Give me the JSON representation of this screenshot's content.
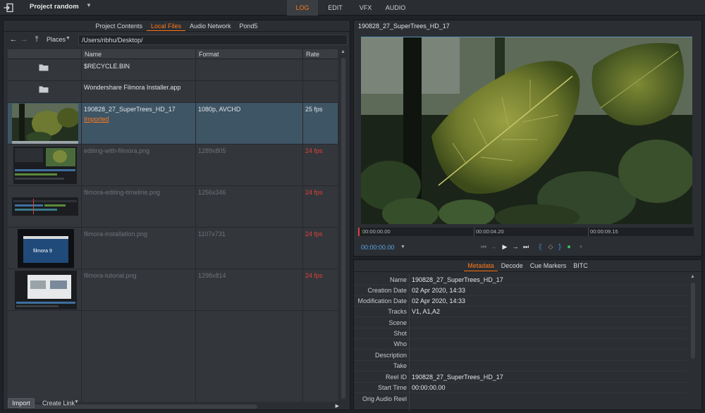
{
  "app": {
    "project_name": "Project random",
    "main_tabs": [
      "LOG",
      "EDIT",
      "VFX",
      "AUDIO"
    ]
  },
  "browser": {
    "tabs": [
      "Project Contents",
      "Local Files",
      "Audio Network",
      "Pond5"
    ],
    "places_label": "Places",
    "path": "/Users/ribhu/Desktop/",
    "columns": [
      "Name",
      "Format",
      "Rate"
    ],
    "rows": [
      {
        "name": "$RECYCLE.BIN",
        "format": "",
        "rate": "",
        "kind": "folder"
      },
      {
        "name": "Wondershare Filmora Installer.app",
        "format": "",
        "rate": "",
        "kind": "folder"
      },
      {
        "name": "190828_27_SuperTrees_HD_17",
        "format": "1080p, AVCHD",
        "rate": "25 fps",
        "kind": "video",
        "status": "Imported"
      },
      {
        "name": "editing-with-filmora.png",
        "format": "1289x805",
        "rate": "24 fps",
        "kind": "image"
      },
      {
        "name": "filmora-editing-timeline.png",
        "format": "1256x346",
        "rate": "24 fps",
        "kind": "image"
      },
      {
        "name": "filmora-installation.png",
        "format": "1107x731",
        "rate": "24 fps",
        "kind": "image"
      },
      {
        "name": "filmora-tutorial.png",
        "format": "1298x814",
        "rate": "24 fps",
        "kind": "image"
      }
    ],
    "import_label": "Import",
    "create_link_label": "Create Link"
  },
  "viewer": {
    "title": "190828_27_SuperTrees_HD_17",
    "ticks": [
      "00:00:00.00",
      "00:00:04.20",
      "00:00:09.15"
    ],
    "timecode": "00:00:00.00"
  },
  "metadata": {
    "tabs": [
      "Metadata",
      "Decode",
      "Cue Markers",
      "BITC"
    ],
    "fields": [
      {
        "label": "Name",
        "value": "190828_27_SuperTrees_HD_17"
      },
      {
        "label": "Creation Date",
        "value": "02 Apr 2020, 14:33"
      },
      {
        "label": "Modification Date",
        "value": "02 Apr 2020, 14:33"
      },
      {
        "label": "Tracks",
        "value": "V1, A1,A2"
      },
      {
        "label": "Scene",
        "value": ""
      },
      {
        "label": "Shot",
        "value": ""
      },
      {
        "label": "Who",
        "value": ""
      },
      {
        "label": "Description",
        "value": ""
      },
      {
        "label": "Take",
        "value": ""
      },
      {
        "label": "Reel ID",
        "value": "190828_27_SuperTrees_HD_17"
      },
      {
        "label": "Start Time",
        "value": "00:00:00.00"
      },
      {
        "label": "Orig Audio Reel",
        "value": ""
      }
    ]
  },
  "colors": {
    "accent": "#ff7a1a",
    "selection": "#3e5566",
    "rate_warning": "#e0413a",
    "timecode": "#5aa8e6"
  }
}
